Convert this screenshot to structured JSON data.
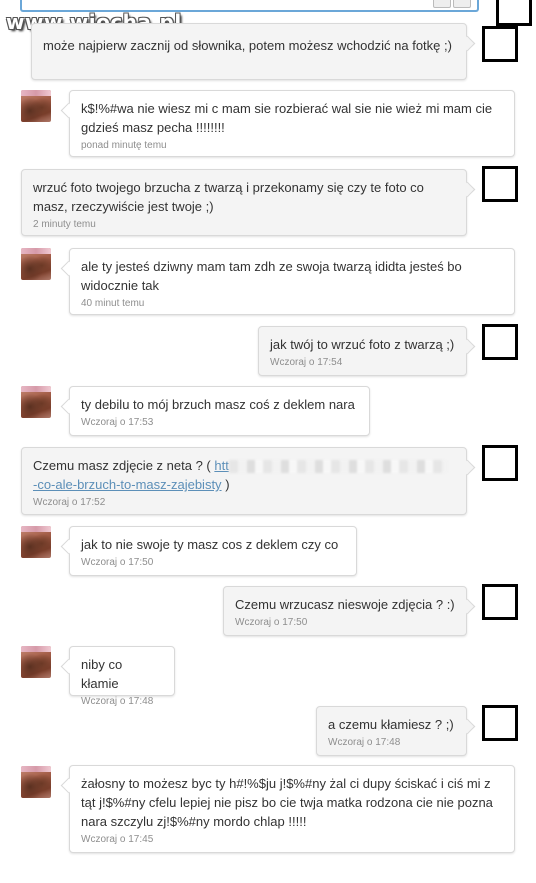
{
  "watermark": {
    "text": "www.wiocha",
    "dot": ".",
    "tld": "pl"
  },
  "messages": [
    {
      "side": "mine",
      "text": "może najpierw zacznij od słownika, potem możesz wchodzić na fotkę ;)",
      "time": ""
    },
    {
      "side": "theirs",
      "text": "k$!%#wa nie wiesz mi c mam sie rozbierać wal sie nie wież mi mam cie gdzieś masz pecha !!!!!!!!",
      "time": "ponad minutę temu"
    },
    {
      "side": "mine",
      "text": "wrzuć foto twojego brzucha z twarzą i przekonamy się czy te foto co masz, rzeczywiście jest twoje ;)",
      "time": "2 minuty temu"
    },
    {
      "side": "theirs",
      "text": "ale ty jesteś dziwny mam tam zdh ze swoja twarzą ididta jesteś bo widocznie tak",
      "time": "40 minut temu"
    },
    {
      "side": "mine",
      "text": "jak twój to wrzuć foto z twarzą ;)",
      "time": "Wczoraj o 17:54"
    },
    {
      "side": "theirs",
      "text": "ty debilu to mój brzuch masz coś z deklem nara",
      "time": "Wczoraj o 17:53"
    },
    {
      "side": "mine",
      "text_prefix": "Czemu masz zdjęcie z neta ? (",
      "link_start": "htt",
      "link_end": "-co-ale-brzuch-to-masz-zajebisty",
      "text_suffix": ")",
      "time": "Wczoraj o 17:52"
    },
    {
      "side": "theirs",
      "text": "jak to nie swoje ty masz cos z deklem czy co",
      "time": "Wczoraj o 17:50"
    },
    {
      "side": "mine",
      "text": "Czemu wrzucasz nieswoje zdjęcia ? :)",
      "time": "Wczoraj o 17:50"
    },
    {
      "side": "theirs",
      "text": "niby co kłamie",
      "time": "Wczoraj o 17:48"
    },
    {
      "side": "mine",
      "text": "a czemu kłamiesz ? ;)",
      "time": "Wczoraj o 17:48"
    },
    {
      "side": "theirs",
      "text": "żałosny to możesz byc ty h#!%$ju j!$%#ny żal ci dupy ściskać i ciś mi z tąt j!$%#ny cfelu lepiej nie pisz bo cie twja matka rodzona cie nie pozna nara szczylu zj!$%#ny mordo chlap !!!!!",
      "time": "Wczoraj o 17:45"
    }
  ]
}
